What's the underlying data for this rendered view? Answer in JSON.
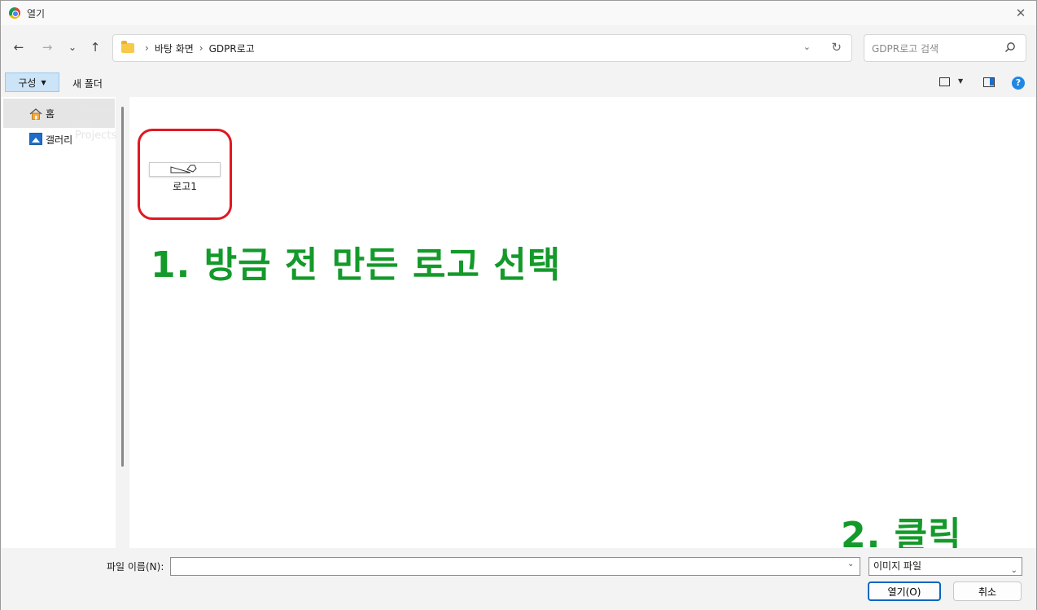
{
  "window": {
    "title": "열기",
    "close_glyph": "✕"
  },
  "nav": {
    "back_glyph": "←",
    "forward_glyph": "→",
    "recent_glyph": "⌄",
    "up_glyph": "↑",
    "breadcrumb": [
      "바탕 화면",
      "GDPR로고"
    ],
    "crumb_separator": "›",
    "search_placeholder": "GDPR로고 검색"
  },
  "toolbar": {
    "organize_label": "구성",
    "new_folder_label": "새 폴더"
  },
  "sidebar": {
    "items": [
      {
        "label": "홈",
        "icon": "home-icon",
        "selected": true
      },
      {
        "label": "갤러리",
        "icon": "gallery-icon",
        "selected": false
      }
    ],
    "ghost_text": "Pinned, the Projects"
  },
  "files": [
    {
      "name": "로고1",
      "type": "image"
    }
  ],
  "annotations": {
    "step1": "1. 방금 전 만든 로고 선택",
    "step2": "2. 클릭",
    "color": "#149a2a",
    "highlight_color": "#e01822"
  },
  "bottom": {
    "filename_label": "파일 이름(N):",
    "filename_value": "",
    "filetype_value": "이미지 파일",
    "open_label": "열기(O)",
    "cancel_label": "취소"
  }
}
